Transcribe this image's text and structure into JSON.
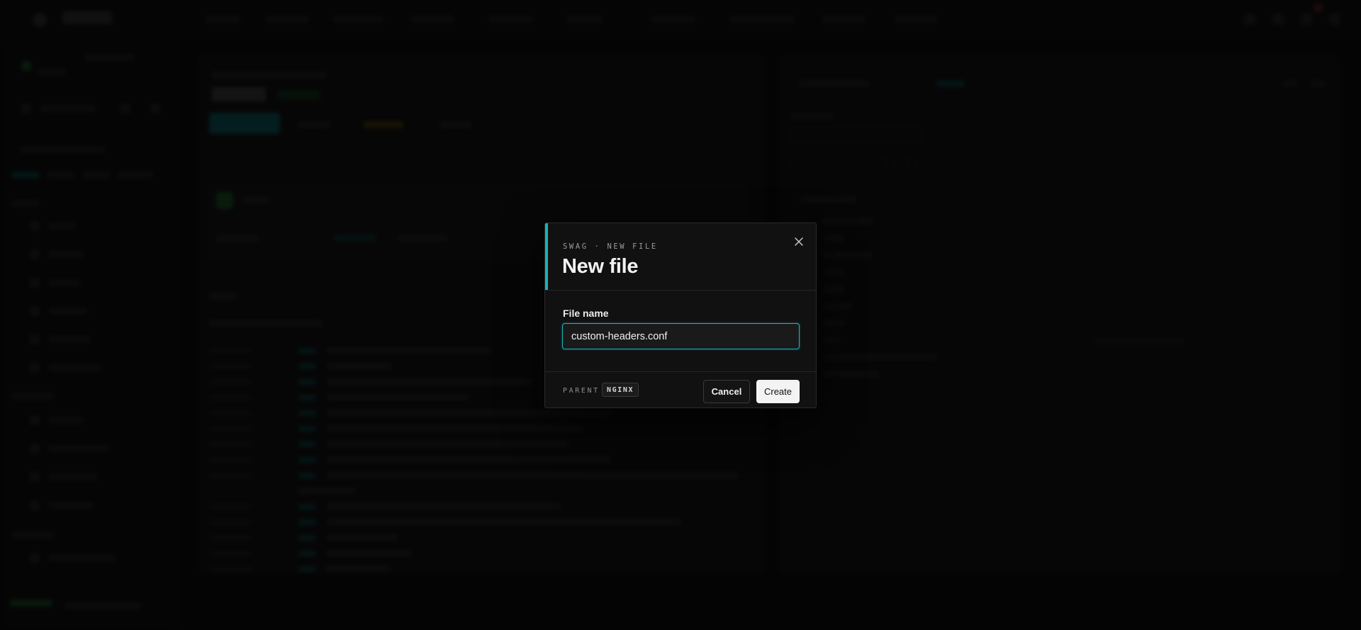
{
  "modal": {
    "eyebrow": "SWAG · NEW FILE",
    "title": "New file",
    "close_icon": "close-icon",
    "field_label": "File name",
    "file_name_value": "custom-headers.conf",
    "parent_label": "PARENT",
    "parent_value": "NGINX",
    "cancel_label": "Cancel",
    "create_label": "Create"
  },
  "colors": {
    "accent": "#18b3b8",
    "background": "#0b0b0b",
    "modal_bg": "#111111",
    "create_button": "#f3f3f3"
  }
}
